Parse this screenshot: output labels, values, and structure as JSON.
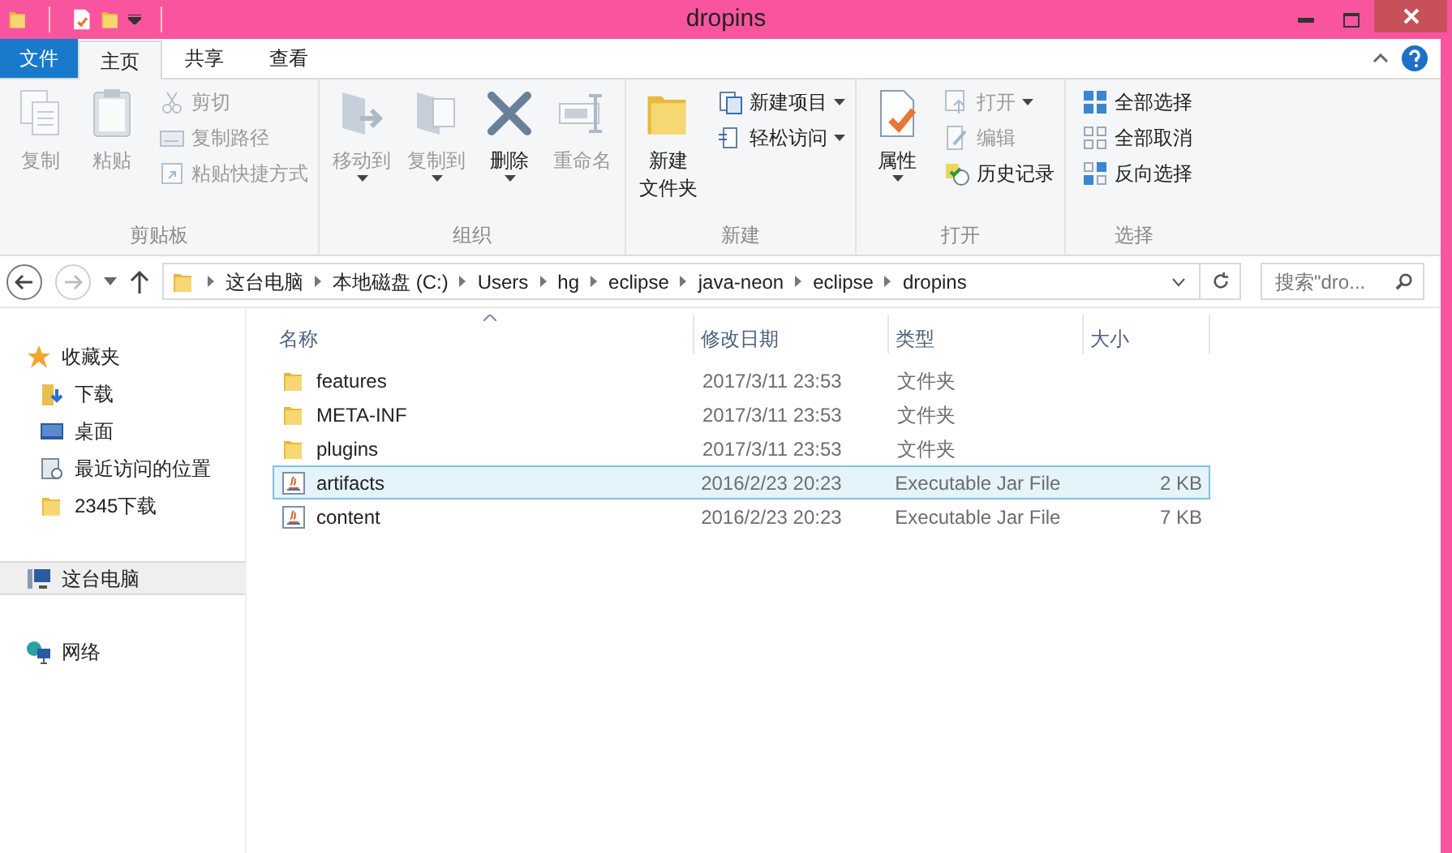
{
  "window": {
    "title": "dropins"
  },
  "ribbon_tabs": [
    {
      "label": "文件",
      "kind": "file",
      "selected": false
    },
    {
      "label": "主页",
      "kind": "tab",
      "selected": true
    },
    {
      "label": "共享",
      "kind": "tab",
      "selected": false
    },
    {
      "label": "查看",
      "kind": "tab",
      "selected": false
    }
  ],
  "ribbon_groups": [
    {
      "label": "剪贴板",
      "items": [
        {
          "label": "复制",
          "kind": "large",
          "disabled": true,
          "has_menu": false
        },
        {
          "label": "粘贴",
          "kind": "large",
          "disabled": true,
          "has_menu": false
        },
        {
          "label": "剪切",
          "kind": "small",
          "disabled": true,
          "has_menu": false
        },
        {
          "label": "复制路径",
          "kind": "small",
          "disabled": true,
          "has_menu": false
        },
        {
          "label": "粘贴快捷方式",
          "kind": "small",
          "disabled": true,
          "has_menu": false
        }
      ]
    },
    {
      "label": "组织",
      "items": [
        {
          "label": "移动到",
          "kind": "large",
          "disabled": true,
          "has_menu": true
        },
        {
          "label": "复制到",
          "kind": "large",
          "disabled": true,
          "has_menu": true
        },
        {
          "label": "删除",
          "kind": "large",
          "disabled": false,
          "has_menu": true
        },
        {
          "label": "重命名",
          "kind": "large",
          "disabled": true,
          "has_menu": false
        }
      ]
    },
    {
      "label": "新建",
      "items": [
        {
          "label": "新建",
          "label_line2": "文件夹",
          "kind": "large",
          "disabled": false,
          "has_menu": false
        },
        {
          "label": "新建项目",
          "kind": "small",
          "disabled": false,
          "has_menu": true
        },
        {
          "label": "轻松访问",
          "kind": "small",
          "disabled": false,
          "has_menu": true
        }
      ]
    },
    {
      "label": "打开",
      "items": [
        {
          "label": "属性",
          "kind": "large",
          "disabled": false,
          "has_menu": true
        },
        {
          "label": "打开",
          "kind": "small",
          "disabled": true,
          "has_menu": true
        },
        {
          "label": "编辑",
          "kind": "small",
          "disabled": true,
          "has_menu": false
        },
        {
          "label": "历史记录",
          "kind": "small",
          "disabled": false,
          "has_menu": false
        }
      ]
    },
    {
      "label": "选择",
      "items": [
        {
          "label": "全部选择",
          "kind": "small",
          "disabled": false,
          "has_menu": false
        },
        {
          "label": "全部取消",
          "kind": "small",
          "disabled": false,
          "has_menu": false
        },
        {
          "label": "反向选择",
          "kind": "small",
          "disabled": false,
          "has_menu": false
        }
      ]
    }
  ],
  "navigation": {
    "back_disabled": false,
    "forward_disabled": true
  },
  "address_bar": {
    "segments": [
      "这台电脑",
      "本地磁盘 (C:)",
      "Users",
      "hg",
      "eclipse",
      "java-neon",
      "eclipse",
      "dropins"
    ]
  },
  "search": {
    "placeholder": "搜索\"dro..."
  },
  "sidebar": {
    "items": [
      {
        "label": "收藏夹",
        "kind": "favorites",
        "selected": false,
        "children": [
          {
            "label": "下载",
            "kind": "downloads",
            "selected": false
          },
          {
            "label": "桌面",
            "kind": "desktop",
            "selected": false
          },
          {
            "label": "最近访问的位置",
            "kind": "recent",
            "selected": false
          },
          {
            "label": "2345下载",
            "kind": "folder",
            "selected": false
          }
        ]
      },
      {
        "label": "这台电脑",
        "kind": "computer",
        "selected": true
      },
      {
        "label": "网络",
        "kind": "network",
        "selected": false
      }
    ]
  },
  "table": {
    "columns": [
      {
        "label": "名称",
        "sorted": true
      },
      {
        "label": "修改日期",
        "sorted": false
      },
      {
        "label": "类型",
        "sorted": false
      },
      {
        "label": "大小",
        "sorted": false
      }
    ],
    "rows": [
      {
        "name": "features",
        "date": "2017/3/11 23:53",
        "type": "文件夹",
        "kind": "folder",
        "selected": false
      },
      {
        "name": "META-INF",
        "date": "2017/3/11 23:53",
        "type": "文件夹",
        "kind": "folder",
        "selected": false
      },
      {
        "name": "plugins",
        "date": "2017/3/11 23:53",
        "type": "文件夹",
        "kind": "folder",
        "selected": false
      },
      {
        "name": "artifacts",
        "date": "2016/2/23 20:23",
        "type": "Executable Jar File",
        "size": "2 KB",
        "kind": "jar",
        "selected": true
      },
      {
        "name": "content",
        "date": "2016/2/23 20:23",
        "type": "Executable Jar File",
        "size": "7 KB",
        "kind": "jar",
        "selected": false
      }
    ]
  }
}
